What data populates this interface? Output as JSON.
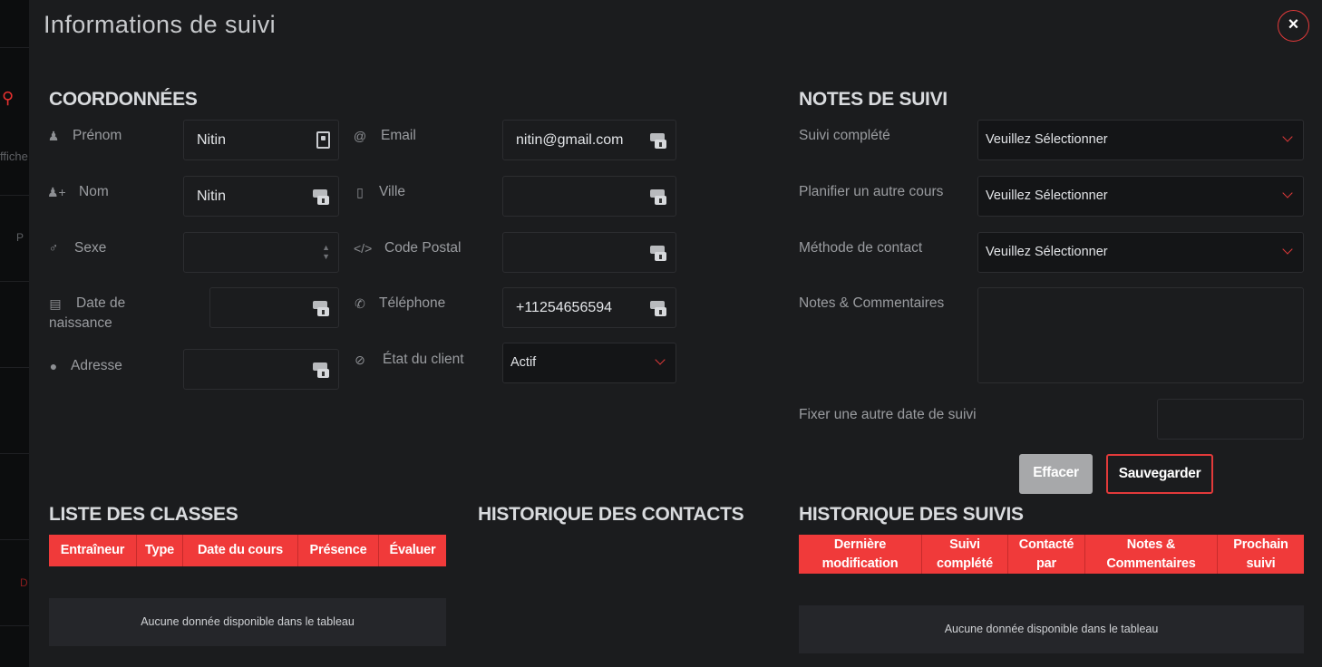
{
  "modal": {
    "title": "Informations de suivi",
    "close_symbol": "×"
  },
  "backdrop": {
    "fragment1": "ffiche",
    "fragment2": "P",
    "fragment3": "D"
  },
  "coordonnees": {
    "title": "COORDONNÉES",
    "prenom": {
      "label": "Prénom",
      "value": "Nitin"
    },
    "nom": {
      "label": "Nom",
      "value": "Nitin"
    },
    "sexe": {
      "label": "Sexe",
      "value": ""
    },
    "date_naissance": {
      "label_line1": "Date de",
      "label_line2": "naissance",
      "value": ""
    },
    "adresse": {
      "label": "Adresse",
      "value": ""
    },
    "email": {
      "label": "Email",
      "value": "nitin@gmail.com"
    },
    "ville": {
      "label": "Ville",
      "value": ""
    },
    "code_postal": {
      "label": "Code Postal",
      "value": ""
    },
    "telephone": {
      "label": "Téléphone",
      "value": "+11254656594"
    },
    "etat_client": {
      "label": "État du client",
      "value": "Actif"
    }
  },
  "notes_suivi": {
    "title": "NOTES DE SUIVI",
    "suivi_complete": {
      "label": "Suivi complété",
      "value": "Veuillez Sélectionner"
    },
    "planifier": {
      "label": "Planifier un autre cours",
      "value": "Veuillez Sélectionner"
    },
    "methode": {
      "label": "Méthode de contact",
      "value": "Veuillez Sélectionner"
    },
    "notes": {
      "label": "Notes & Commentaires",
      "value": ""
    },
    "fixer_date": {
      "label": "Fixer une autre date de suivi",
      "value": ""
    },
    "btn_effacer": "Effacer",
    "btn_sauvegarder": "Sauvegarder"
  },
  "liste_classes": {
    "title": "LISTE DES CLASSES",
    "columns": [
      "Entraîneur",
      "Type",
      "Date du cours",
      "Présence",
      "Évaluer"
    ],
    "empty": "Aucune donnée disponible dans le tableau"
  },
  "historique_contacts": {
    "title": "HISTORIQUE DES CONTACTS"
  },
  "historique_suivis": {
    "title": "HISTORIQUE DES SUIVIS",
    "columns": [
      [
        "Dernière",
        "modification"
      ],
      [
        "Suivi",
        "complété"
      ],
      [
        "Contacté",
        "par"
      ],
      [
        "Notes &",
        "Commentaires"
      ],
      [
        "Prochain",
        "suivi"
      ]
    ],
    "empty": "Aucune donnée disponible dans le tableau"
  },
  "colors": {
    "accent": "#f03a3a",
    "modal_bg": "#1b1c1e",
    "button_gray": "#a7a8aa"
  }
}
